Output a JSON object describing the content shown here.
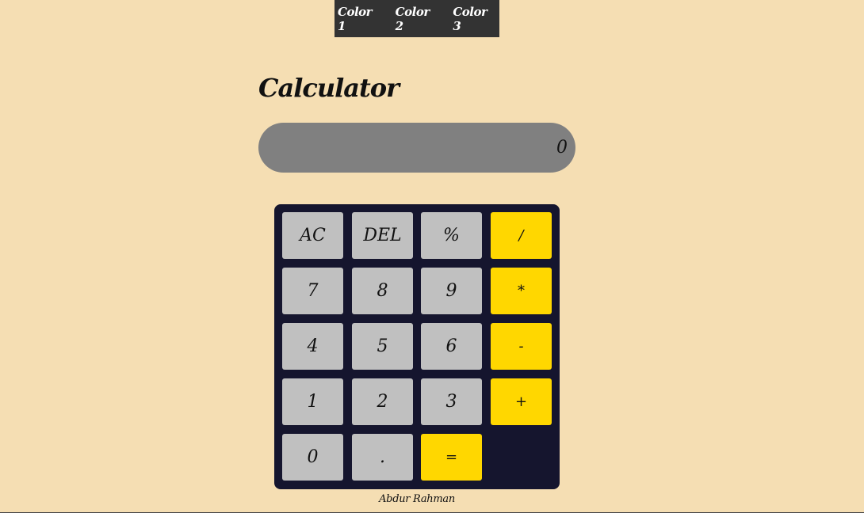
{
  "nav": {
    "items": [
      "Color 1",
      "Color 2",
      "Color 3"
    ]
  },
  "title": "Calculator",
  "display": {
    "value": "0"
  },
  "keys": {
    "ac": "AC",
    "del": "DEL",
    "percent": "%",
    "divide": "/",
    "seven": "7",
    "eight": "8",
    "nine": "9",
    "multiply": "*",
    "four": "4",
    "five": "5",
    "six": "6",
    "minus": "-",
    "one": "1",
    "two": "2",
    "three": "3",
    "plus": "+",
    "zero": "0",
    "decimal": ".",
    "equals": "="
  },
  "footer": {
    "author": "Abdur Rahman"
  },
  "colors": {
    "background": "#f5deb3",
    "nav": "#333333",
    "display": "#808080",
    "keypad": "#15152e",
    "key": "#c0c0c0",
    "operator_key": "#ffd700"
  }
}
